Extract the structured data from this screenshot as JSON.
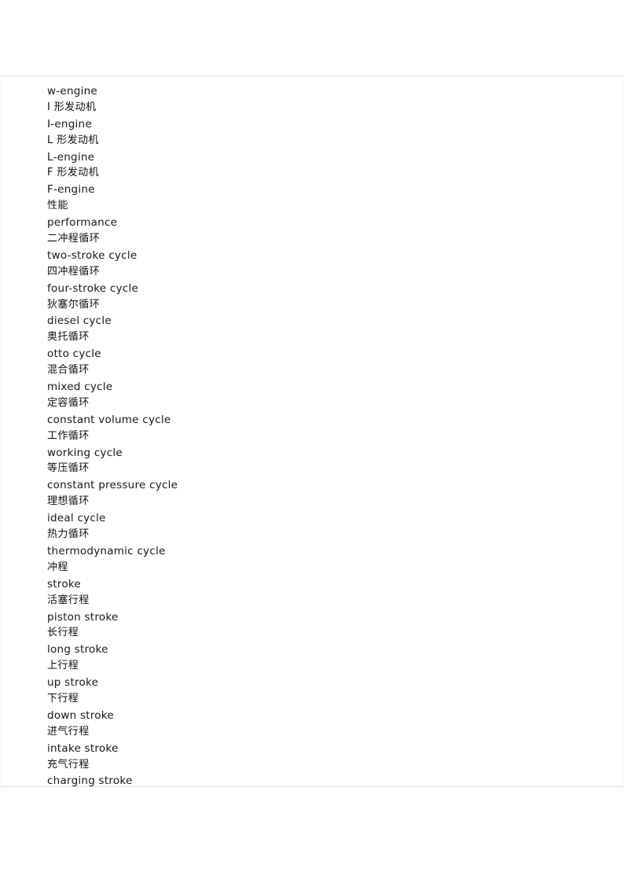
{
  "document": {
    "type": "bilingual-glossary",
    "subject": "internal combustion engine terminology",
    "languages": [
      "zh-CN",
      "en"
    ]
  },
  "glossary": {
    "entries": [
      {
        "lang": "en",
        "text": "w-engine"
      },
      {
        "lang": "zh",
        "text": "I 形发动机"
      },
      {
        "lang": "en",
        "text": "I-engine"
      },
      {
        "lang": "zh",
        "text": "L 形发动机"
      },
      {
        "lang": "en",
        "text": "L-engine"
      },
      {
        "lang": "zh",
        "text": "F 形发动机"
      },
      {
        "lang": "en",
        "text": "F-engine"
      },
      {
        "lang": "zh",
        "text": "性能"
      },
      {
        "lang": "en",
        "text": "performance"
      },
      {
        "lang": "zh",
        "text": "二冲程循环"
      },
      {
        "lang": "en",
        "text": "two-stroke cycle"
      },
      {
        "lang": "zh",
        "text": "四冲程循环"
      },
      {
        "lang": "en",
        "text": "four-stroke cycle"
      },
      {
        "lang": "zh",
        "text": "狄塞尔循环"
      },
      {
        "lang": "en",
        "text": "diesel cycle"
      },
      {
        "lang": "zh",
        "text": "奥托循环"
      },
      {
        "lang": "en",
        "text": "otto cycle"
      },
      {
        "lang": "zh",
        "text": "混合循环"
      },
      {
        "lang": "en",
        "text": "mixed cycle"
      },
      {
        "lang": "zh",
        "text": "定容循环"
      },
      {
        "lang": "en",
        "text": "constant volume cycle"
      },
      {
        "lang": "zh",
        "text": "工作循环"
      },
      {
        "lang": "en",
        "text": "working cycle"
      },
      {
        "lang": "zh",
        "text": "等压循环"
      },
      {
        "lang": "en",
        "text": "constant pressure cycle"
      },
      {
        "lang": "zh",
        "text": "理想循环"
      },
      {
        "lang": "en",
        "text": "ideal cycle"
      },
      {
        "lang": "zh",
        "text": "热力循环"
      },
      {
        "lang": "en",
        "text": "thermodynamic cycle"
      },
      {
        "lang": "zh",
        "text": "冲程"
      },
      {
        "lang": "en",
        "text": "stroke"
      },
      {
        "lang": "zh",
        "text": "活塞行程"
      },
      {
        "lang": "en",
        "text": "piston stroke"
      },
      {
        "lang": "zh",
        "text": "长行程"
      },
      {
        "lang": "en",
        "text": "long stroke"
      },
      {
        "lang": "zh",
        "text": "上行程"
      },
      {
        "lang": "en",
        "text": "up stroke"
      },
      {
        "lang": "zh",
        "text": "下行程"
      },
      {
        "lang": "en",
        "text": "down stroke"
      },
      {
        "lang": "zh",
        "text": "进气行程"
      },
      {
        "lang": "en",
        "text": "intake stroke"
      },
      {
        "lang": "zh",
        "text": "充气行程"
      },
      {
        "lang": "en",
        "text": "charging stroke"
      }
    ]
  },
  "colors": {
    "page_background": "#ffffff",
    "rule": "#e2e2e2",
    "edge_rule": "#f1f1f1",
    "text": "#1a1a1a"
  }
}
